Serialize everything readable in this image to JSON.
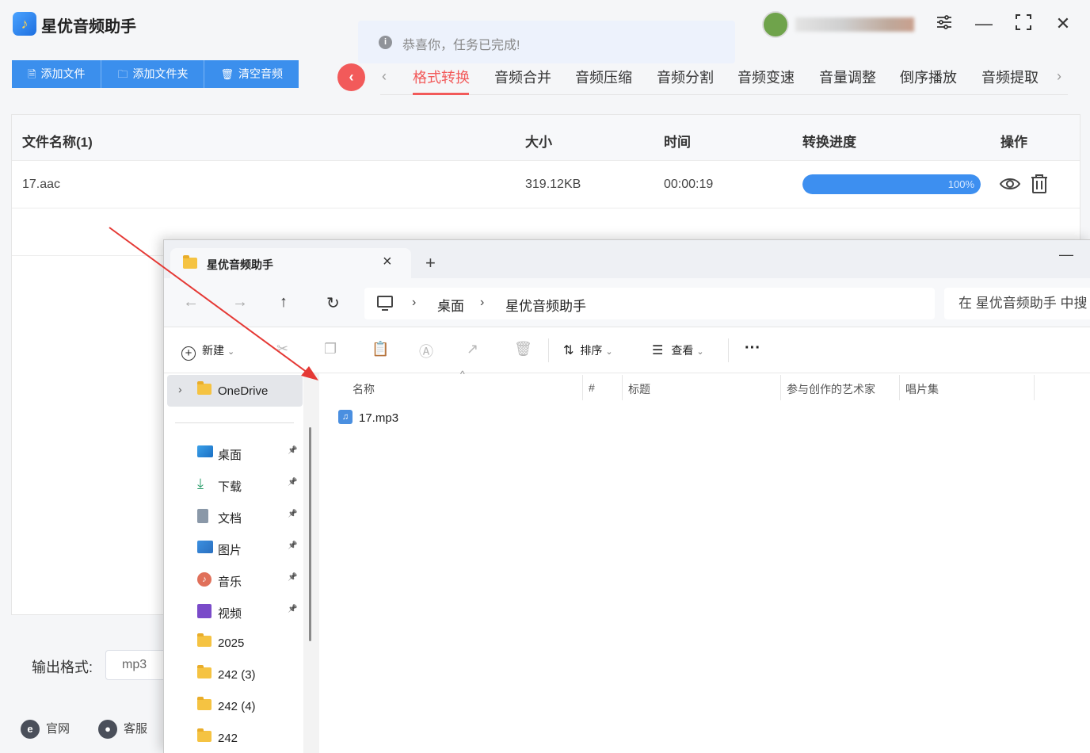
{
  "app": {
    "title": "星优音频助手",
    "toast": "恭喜你，任务已完成!",
    "toolbar": {
      "add_file": "添加文件",
      "add_folder": "添加文件夹",
      "clear": "清空音频"
    },
    "tabs": [
      "格式转换",
      "音频合并",
      "音频压缩",
      "音频分割",
      "音频变速",
      "音量调整",
      "倒序播放",
      "音频提取"
    ],
    "active_tab": "格式转换",
    "table": {
      "headers": {
        "name": "文件名称(1)",
        "size": "大小",
        "time": "时间",
        "progress": "转换进度",
        "actions": "操作"
      },
      "rows": [
        {
          "name": "17.aac",
          "size": "319.12KB",
          "time": "00:00:19",
          "progress_label": "100%",
          "progress_value": 1.0
        }
      ]
    },
    "output": {
      "label": "输出格式:",
      "value": "mp3"
    },
    "footer": {
      "website": "官网",
      "support": "客服"
    }
  },
  "explorer": {
    "tab_title": "星优音频助手",
    "breadcrumb": [
      "桌面",
      "星优音频助手"
    ],
    "search_placeholder": "在 星优音频助手 中搜",
    "commands": {
      "new": "新建",
      "sort": "排序",
      "view": "查看"
    },
    "nav": {
      "onedrive": "OneDrive",
      "quick_access": [
        {
          "label": "桌面",
          "icon": "desktop-icon",
          "pinned": true
        },
        {
          "label": "下载",
          "icon": "download-icon",
          "pinned": true
        },
        {
          "label": "文档",
          "icon": "document-icon",
          "pinned": true
        },
        {
          "label": "图片",
          "icon": "picture-icon",
          "pinned": true
        },
        {
          "label": "音乐",
          "icon": "music-icon",
          "pinned": true
        },
        {
          "label": "视频",
          "icon": "video-icon",
          "pinned": true
        },
        {
          "label": "2025",
          "icon": "folder-icon",
          "pinned": false
        },
        {
          "label": "242 (3)",
          "icon": "folder-icon",
          "pinned": false
        },
        {
          "label": "242 (4)",
          "icon": "folder-icon",
          "pinned": false
        },
        {
          "label": "242",
          "icon": "folder-icon",
          "pinned": false
        }
      ]
    },
    "columns": [
      "名称",
      "#",
      "标题",
      "参与创作的艺术家",
      "唱片集"
    ],
    "files": [
      {
        "name": "17.mp3",
        "icon": "audio-file-icon"
      }
    ]
  },
  "colors": {
    "accent_blue": "#3b8fed",
    "accent_red": "#f25a5a",
    "arrow_red": "#e53935"
  }
}
